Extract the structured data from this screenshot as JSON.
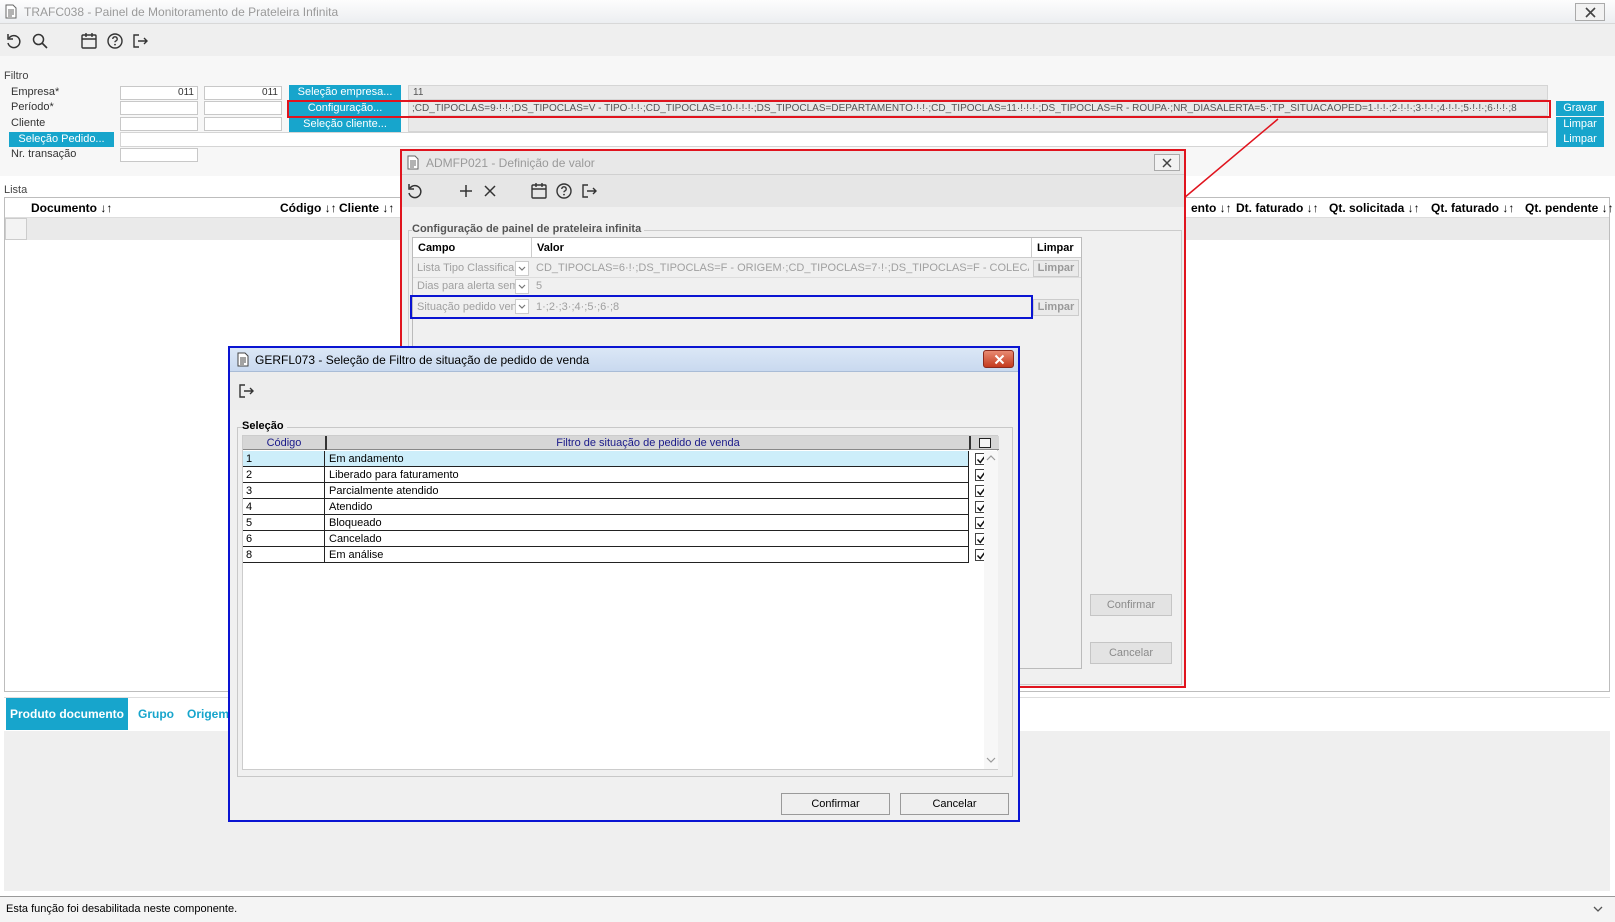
{
  "main_window": {
    "title": "TRAFC038 - Painel de Monitoramento de Prateleira Infinita",
    "filter_title": "Filtro",
    "labels": {
      "empresa": "Empresa*",
      "periodo": "Período*",
      "cliente": "Cliente",
      "nr_transacao": "Nr. transação"
    },
    "empresa_values": [
      "011",
      "011"
    ],
    "buttons": {
      "selecao_empresa": "Seleção empresa...",
      "configuracao": "Configuração...",
      "selecao_cliente": "Seleção cliente...",
      "selecao_pedido": "Seleção Pedido...",
      "gravar": "Gravar",
      "limpar1": "Limpar",
      "limpar2": "Limpar"
    },
    "empresa_display": "11",
    "configuracao_display": ";CD_TIPOCLAS=9·!·!·;DS_TIPOCLAS=V - TIPO·!·!·;CD_TIPOCLAS=10·!·!·!·;DS_TIPOCLAS=DEPARTAMENTO·!·!·;CD_TIPOCLAS=11·!·!·!·;DS_TIPOCLAS=R - ROUPA·;NR_DIASALERTA=5·;TP_SITUACAOPED=1·!·!·;2·!·!·;3·!·!·;4·!·!·;5·!·!·;6·!·!·;8",
    "lista_title": "Lista",
    "lista_columns_left": [
      "Documento ↓↑",
      "Código ↓↑",
      "Cliente ↓↑"
    ],
    "lista_columns_right": [
      "ento ↓↑",
      "Dt. faturado ↓↑",
      "Qt. solicitada ↓↑",
      "Qt. faturado ↓↑",
      "Qt. pendente ↓↑"
    ],
    "bottom_tabs": [
      "Produto documento",
      "Grupo",
      "Origem"
    ],
    "status_text": "Esta função foi desabilitada neste componente."
  },
  "admfp_window": {
    "title": "ADMFP021 - Definição de valor",
    "group_title": "Configuração de painel de prateleira infinita",
    "columns": [
      "Campo",
      "Valor",
      "Limpar"
    ],
    "rows": [
      {
        "campo": "Lista Tipo Classifica",
        "valor": "CD_TIPOCLAS=6·!·;DS_TIPOCLAS=F - ORIGEM·;CD_TIPOCLAS=7·!·;DS_TIPOCLAS=F - COLECAO·;CD_",
        "limpar": "Limpar"
      },
      {
        "campo": "Dias para alerta sem",
        "valor": "5",
        "limpar": ""
      },
      {
        "campo": "Situação pedido ven",
        "valor": "1·;2·;3·;4·;5·;6·;8",
        "limpar": "Limpar"
      }
    ],
    "buttons": {
      "confirmar": "Confirmar",
      "cancelar": "Cancelar"
    }
  },
  "gerfl_window": {
    "title": "GERFL073 - Seleção de Filtro de situação de pedido de venda",
    "group_title": "Seleção",
    "columns": [
      "Código",
      "Filtro de situação de pedido de venda"
    ],
    "rows": [
      {
        "codigo": "1",
        "descricao": "Em andamento",
        "checked": true
      },
      {
        "codigo": "2",
        "descricao": "Liberado para faturamento",
        "checked": true
      },
      {
        "codigo": "3",
        "descricao": "Parcialmente atendido",
        "checked": true
      },
      {
        "codigo": "4",
        "descricao": "Atendido",
        "checked": true
      },
      {
        "codigo": "5",
        "descricao": "Bloqueado",
        "checked": true
      },
      {
        "codigo": "6",
        "descricao": "Cancelado",
        "checked": true
      },
      {
        "codigo": "8",
        "descricao": "Em análise",
        "checked": true
      }
    ],
    "buttons": {
      "confirmar": "Confirmar",
      "cancelar": "Cancelar"
    }
  },
  "colors": {
    "accent": "#17a5cc",
    "red_highlight": "#e0141e",
    "blue_highlight": "#0a14d2"
  }
}
